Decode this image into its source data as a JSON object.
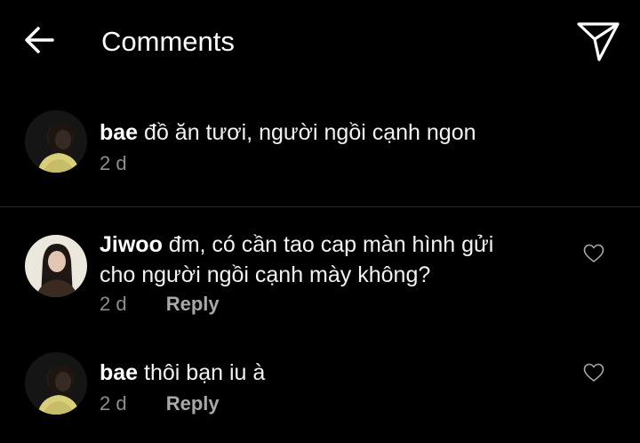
{
  "header": {
    "title": "Comments",
    "back_icon": "arrow-left-icon",
    "send_icon": "paper-plane-icon"
  },
  "caption": {
    "user": "bae",
    "text": "đồ ăn tươi, người ngồi cạnh ngon",
    "time": "2 d"
  },
  "comments": [
    {
      "user": "Jiwoo",
      "text_line1": "đm, có cần tao cap màn hình gửi",
      "text_line2": "cho người ngồi cạnh mày không?",
      "time": "2 d",
      "reply_label": "Reply",
      "like_icon": "heart-outline-icon"
    },
    {
      "user": "bae",
      "text_line1": "thôi bạn iu à",
      "time": "2 d",
      "reply_label": "Reply",
      "like_icon": "heart-outline-icon"
    }
  ],
  "colors": {
    "background": "#000000",
    "text_primary": "#ffffff",
    "text_secondary": "#8e8e8e",
    "divider": "#2a2a2a"
  }
}
